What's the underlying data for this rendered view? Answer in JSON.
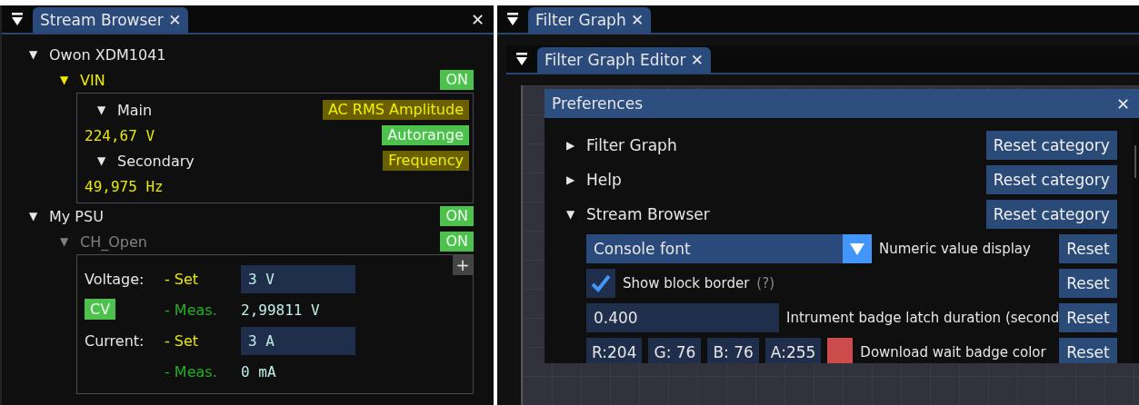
{
  "left_panel": {
    "tab": {
      "label": "Stream Browser",
      "close": "✕",
      "selected": true
    },
    "close": "✕",
    "devices": [
      {
        "toggle": "▼",
        "name": "Owon XDM1041",
        "channels": [
          {
            "toggle": "▼",
            "name": "VIN",
            "active": true,
            "badge": "ON",
            "block": {
              "kind": "meter",
              "functions": [
                {
                  "toggle": "▼",
                  "label": "Main",
                  "mode": "AC RMS Amplitude",
                  "value": "224,67 V",
                  "range": "Autorange"
                },
                {
                  "toggle": "▼",
                  "label": "Secondary",
                  "mode": "Frequency",
                  "value": "49,975 Hz"
                }
              ]
            }
          }
        ]
      },
      {
        "toggle": "▼",
        "name": "My PSU",
        "badge": "ON",
        "channels": [
          {
            "toggle": "▼",
            "name": "CH_Open",
            "active": false,
            "badge": "ON",
            "block": {
              "kind": "psu",
              "add": "+",
              "mode": "CV",
              "quantities": [
                {
                  "label": "Voltage:",
                  "set_label": "- Set",
                  "set_value": "3 V",
                  "meas_label": "- Meas.",
                  "meas_value": "2,99811 V"
                },
                {
                  "label": "Current:",
                  "set_label": "- Set",
                  "set_value": "3 A",
                  "meas_label": "- Meas.",
                  "meas_value": "0 mA"
                }
              ]
            }
          }
        ]
      }
    ]
  },
  "right_panel": {
    "tab": {
      "label": "Filter Graph",
      "close": "✕",
      "selected": true
    },
    "editor_tab": {
      "label": "Filter Graph Editor",
      "close": "✕",
      "selected": true
    },
    "preferences": {
      "title": "Preferences",
      "close": "✕",
      "categories": [
        {
          "toggle": "▶",
          "label": "Filter Graph",
          "reset": "Reset category"
        },
        {
          "toggle": "▶",
          "label": "Help",
          "reset": "Reset category"
        },
        {
          "toggle": "▼",
          "label": "Stream Browser",
          "reset": "Reset category",
          "settings": [
            {
              "kind": "dropdown",
              "selection": "Console font",
              "label": "Numeric value display",
              "reset": "Reset"
            },
            {
              "kind": "checkbox",
              "checked": true,
              "label": "Show block border",
              "hint": "(?)",
              "reset": "Reset"
            },
            {
              "kind": "number",
              "input_text": "0.400",
              "label": "Intrument badge latch duration (second",
              "reset": "Reset"
            },
            {
              "kind": "color",
              "channels": [
                "R:204",
                "G: 76",
                "B: 76",
                "A:255"
              ],
              "color": "#cc4c4c",
              "label": "Download wait badge color",
              "reset": "Reset"
            }
          ]
        }
      ]
    }
  }
}
